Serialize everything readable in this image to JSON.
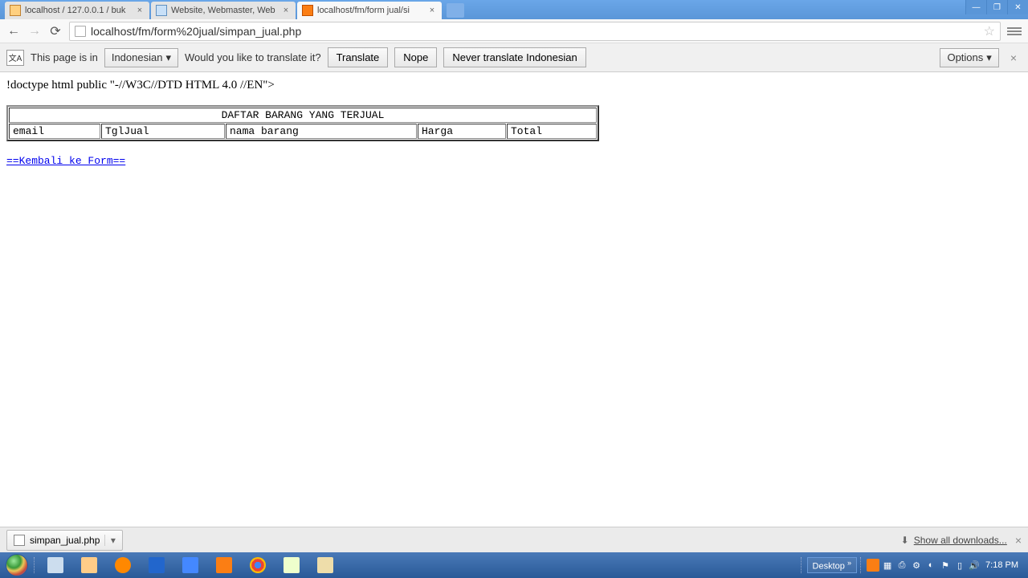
{
  "tabs": [
    {
      "title": "localhost / 127.0.0.1 / buk",
      "active": false
    },
    {
      "title": "Website, Webmaster, Web",
      "active": false
    },
    {
      "title": "localhost/fm/form jual/si",
      "active": true
    }
  ],
  "url_display": "localhost/fm/form%20jual/simpan_jual.php",
  "translate": {
    "prefix": "This page is in",
    "language": "Indonesian",
    "question": "Would you like to translate it?",
    "btn_translate": "Translate",
    "btn_nope": "Nope",
    "btn_never": "Never translate Indonesian",
    "btn_options": "Options"
  },
  "page": {
    "doctype_text": "!doctype html public \"-//W3C//DTD HTML 4.0 //EN\">",
    "table_caption": "DAFTAR BARANG YANG TERJUAL",
    "columns": [
      "email",
      "TglJual",
      "nama barang",
      "Harga",
      "Total"
    ],
    "back_link": "==Kembali ke Form=="
  },
  "downloads": {
    "item": "simpan_jual.php",
    "show_all": "Show all downloads..."
  },
  "tray": {
    "desktop_label": "Desktop",
    "time": "7:18 PM"
  }
}
